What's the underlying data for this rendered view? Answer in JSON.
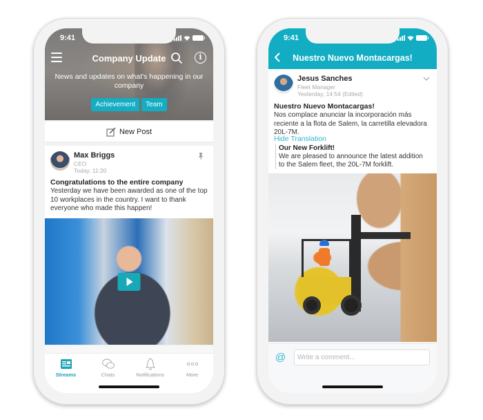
{
  "left_phone": {
    "status": {
      "time": "9:41"
    },
    "header": {
      "title": "Company Update",
      "subtitle": "News and updates on what's happening in our company",
      "tags": [
        "Achievement",
        "Team"
      ]
    },
    "new_post_label": "New Post",
    "post": {
      "author": "Max Briggs",
      "role": "CEO",
      "time": "Today, 11:20",
      "title": "Congratulations to the entire company",
      "body": "Yesterday we have been awarded as one of the top 10 workplaces in the country. I want to thank everyone who made this happen!"
    },
    "tabbar": {
      "items": [
        {
          "label": "Streams",
          "icon": "streams-icon",
          "active": true
        },
        {
          "label": "Chats",
          "icon": "chat-icon",
          "active": false
        },
        {
          "label": "Notifications",
          "icon": "bell-icon",
          "active": false
        },
        {
          "label": "More",
          "icon": "more-icon",
          "active": false
        }
      ]
    },
    "colors": {
      "accent": "#13adc4"
    }
  },
  "right_phone": {
    "status": {
      "time": "9:41"
    },
    "header": {
      "title": "Nuestro Nuevo Montacargas!"
    },
    "post": {
      "author": "Jesus  Sanches",
      "role": "Fleet Manager",
      "time": "Yesterday, 14:54 (Edited)",
      "title": "Nuestro Nuevo Montacargas!",
      "body": "Nos complace anunciar la incorporación más reciente a la flota de Salem, la carretilla elevadora 20L-7M.",
      "translation_toggle": "Hide Translation",
      "translation": {
        "title": "Our New Forklift!",
        "body": "We are pleased to announce the latest addition to the Salem fleet, the 20L-7M forklift."
      }
    },
    "comment": {
      "placeholder": "Write a comment..."
    },
    "colors": {
      "header": "#12adc3",
      "link": "#2cb3cf"
    }
  }
}
